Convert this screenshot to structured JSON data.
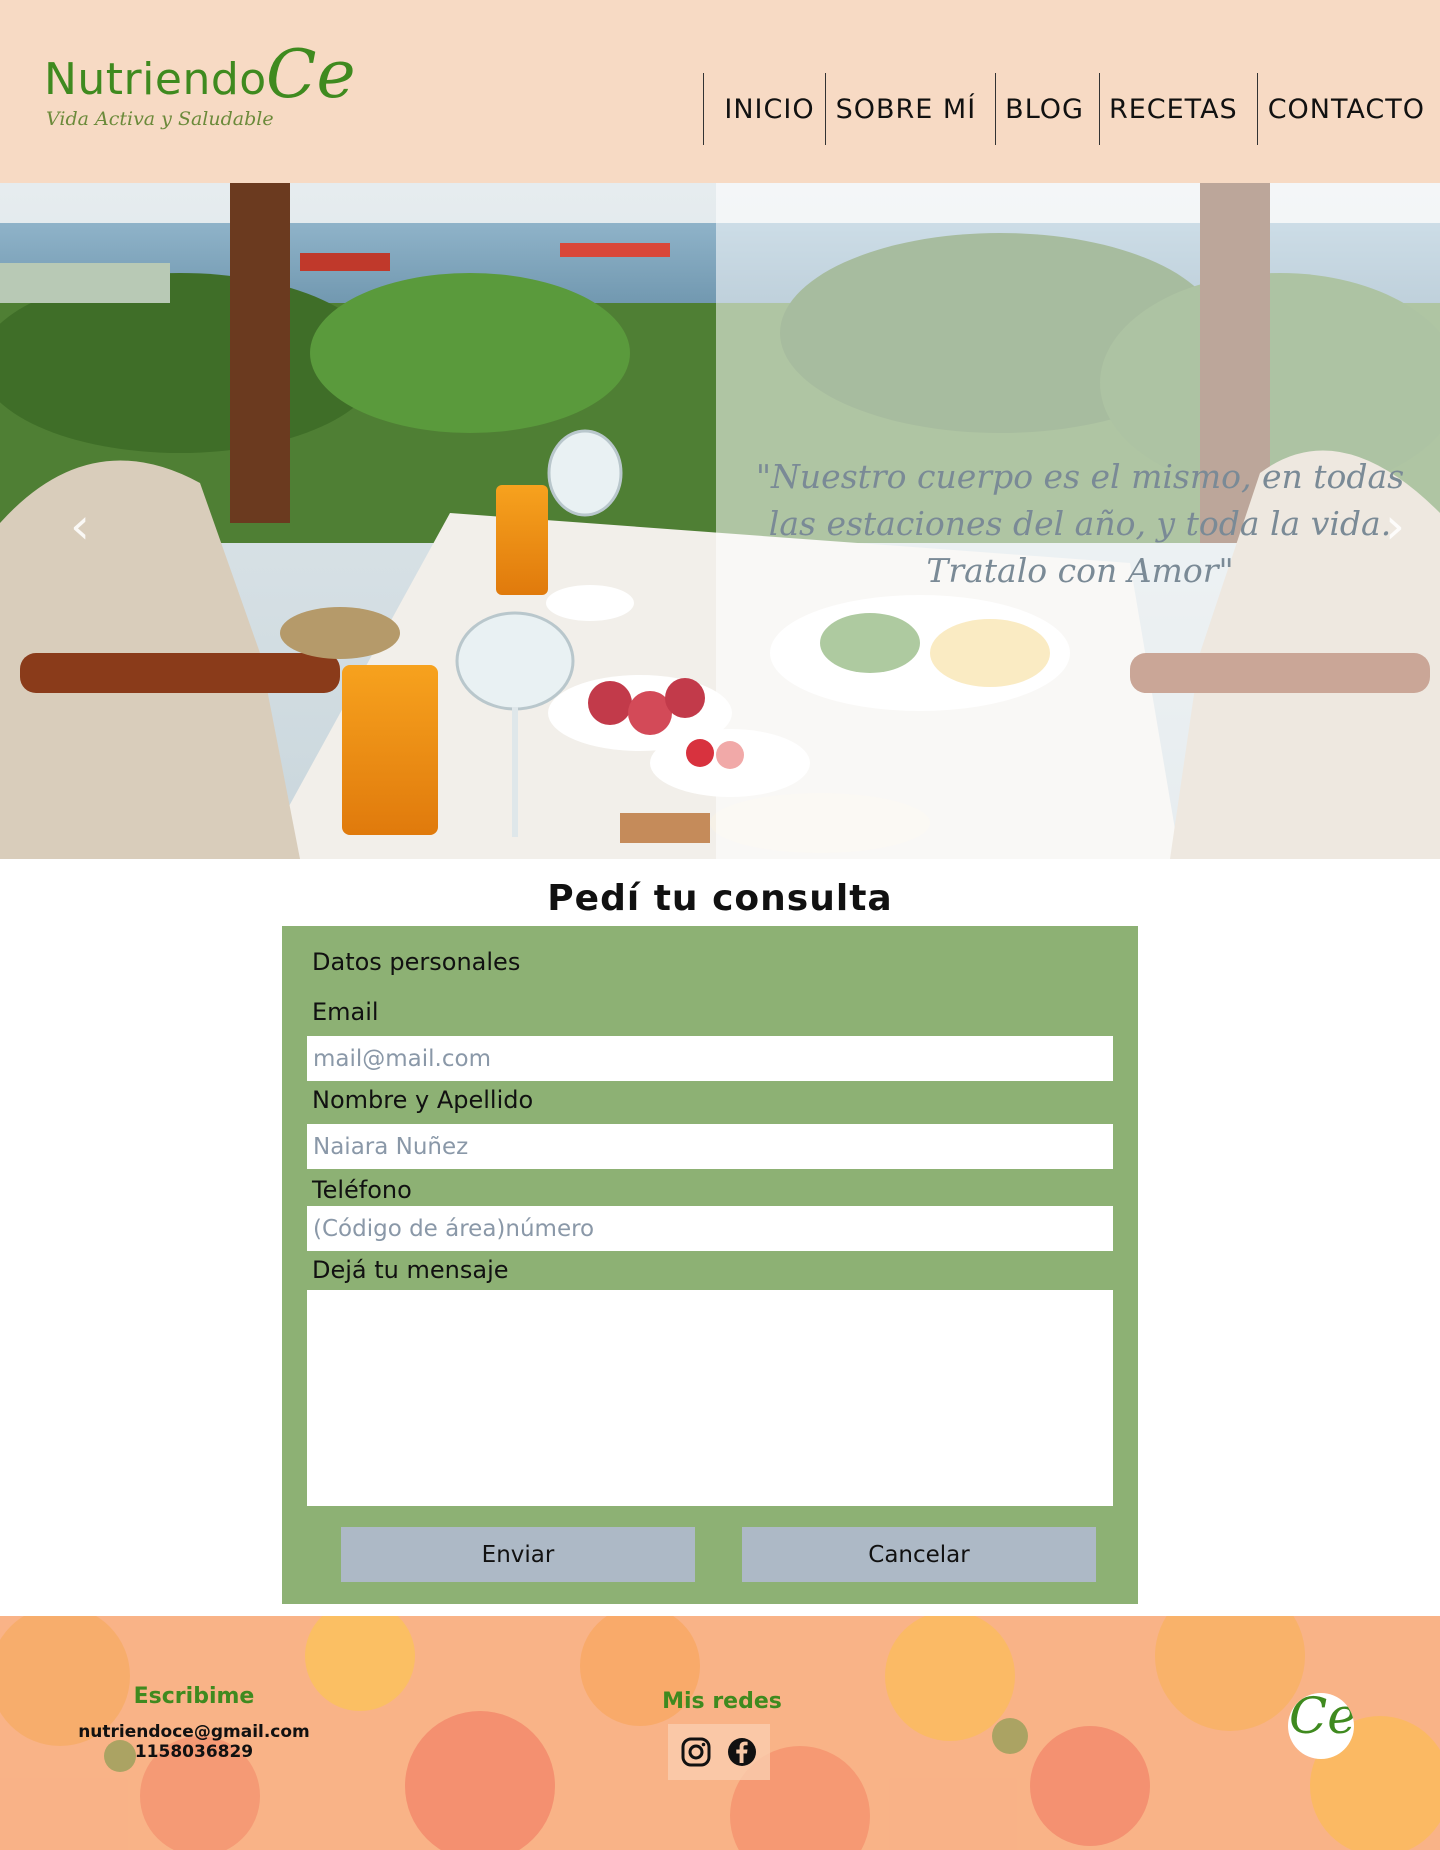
{
  "header": {
    "logo_word": "Nutriendo",
    "logo_mark": "Ce",
    "logo_tagline": "Vida Activa y Saludable",
    "nav": [
      "INICIO",
      "SOBRE MÍ",
      "BLOG",
      "RECETAS",
      "CONTACTO"
    ]
  },
  "hero": {
    "quote": "\"Nuestro cuerpo es el mismo, en todas las estaciones del año, y toda la vida. Tratalo con Amor\"",
    "prev_icon": "chevron-left-icon",
    "next_icon": "chevron-right-icon",
    "prev_glyph": "‹",
    "next_glyph": "›"
  },
  "form": {
    "title": "Pedí tu consulta",
    "legend": "Datos personales",
    "email_label": "Email",
    "email_placeholder": "mail@mail.com",
    "name_label": "Nombre y Apellido",
    "name_placeholder": "Naiara Nuñez",
    "phone_label": "Teléfono",
    "phone_placeholder": "(Código de área)número",
    "message_label": "Dejá tu mensaje",
    "message_value": "",
    "send_label": "Enviar",
    "cancel_label": "Cancelar"
  },
  "footer": {
    "write_title": "Escribime",
    "email": "nutriendoce@gmail.com",
    "phone": "1158036829",
    "socials_title": "Mis redes",
    "socials": [
      "instagram-icon",
      "facebook-icon"
    ],
    "logo_mark": "Ce"
  },
  "colors": {
    "header_bg": "#f7dac4",
    "brand_green": "#3f8a1f",
    "form_bg": "#8db174",
    "button_bg": "#adb9c6",
    "footer_bg": "#f9b083"
  }
}
